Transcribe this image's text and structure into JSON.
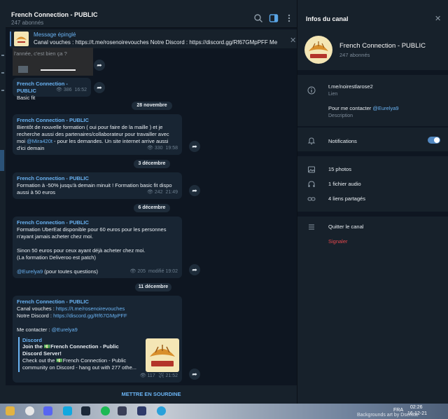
{
  "chat": {
    "title": "French Connection - PUBLIC",
    "subtitle": "247 abonnés",
    "pinned": {
      "label": "Message épinglé",
      "text": "Canal vouches : https://t.me/rosenoirevouches Notre Discord : https://discord.gg/Rf67GMpPFF  Me cont..."
    },
    "photo_caption_fragment": "l'année, c'est bien ça ?",
    "messages": [
      {
        "author": "French Connection - PUBLIC",
        "lines": [
          "Basic fit"
        ],
        "views": "386",
        "time": "16:52"
      },
      {
        "date": "28 novembre"
      },
      {
        "author": "French Connection - PUBLIC",
        "line1": "Bientôt de nouvelle formation ( oui pour faire de la maille ) et je",
        "line2": "recherche aussi des partenaires/collaborateur pour travailler avec",
        "line3_pre": "moi ",
        "line3_link": "@Mira420t",
        "line3_post": " - pour les demandes. Un site internet arrive aussi",
        "line4": "d'ici demain",
        "views": "330",
        "time": "19:58"
      },
      {
        "date": "3 décembre"
      },
      {
        "author": "French Connection - PUBLIC",
        "line1": "Formation à -50% jusqu'à demain minuit ! Formation basic fit dispo",
        "line2": "aussi à 50 euros",
        "views": "242",
        "time": "21:49"
      },
      {
        "date": "6 décembre"
      },
      {
        "author": "French Connection - PUBLIC",
        "line1": "Formation UberEat disponible pour 60 euros pour les personnes",
        "line2": "n'ayant jamais acheter chez moi.",
        "line3": "Sinon 50 euros pour ceux ayant déjà acheter chez moi.",
        "line4": "(La formation Deliveroo est patch)",
        "line5_link": "@Eurelya9",
        "line5_post": " (pour toutes questions)",
        "views": "205",
        "edited": "modifié",
        "time": "19:02"
      },
      {
        "date": "11 décembre"
      },
      {
        "author": "French Connection - PUBLIC",
        "l1_pre": "Canal vouches : ",
        "l1_link": "https://t.me/rosenoirevouches",
        "l2_pre": "Notre Discord : ",
        "l2_link": "https://discord.gg/Rf67GMpPFF",
        "l3_pre": "Me contacter : ",
        "l3_link": "@Eurelya9",
        "preview": {
          "source": "Discord",
          "title": "Join the 💵French Connection - Public Discord Server!",
          "desc": "Check out the 💵French Connection - Public community on Discord - hang out with 277 othe..."
        },
        "views": "117",
        "time": "21:52"
      }
    ],
    "mute_button": "METTRE EN SOURDINE"
  },
  "info": {
    "header": "Infos du canal",
    "name": "French Connection - PUBLIC",
    "subscribers": "247 abonnés",
    "link_value": "t.me/noirestlarose2",
    "link_label": "Lien",
    "description_pre": "Pour me contacter ",
    "description_link": "@Eurelya9",
    "description_label": "Description",
    "notifications_label": "Notifications",
    "notifications_on": true,
    "photos": "15 photos",
    "audio": "1 fichier audio",
    "links": "4 liens partagés",
    "leave": "Quitter le canal",
    "report": "Signaler"
  },
  "logo_text": "FRENCH CONNECTION",
  "taskbar": {
    "lang": "FRA",
    "time": "02:26",
    "date": "16-12-21",
    "wallpaper_credit": "Backgrounds art by Dsenxtc"
  },
  "colors": {
    "bg": "#0e1621",
    "panel": "#17212b",
    "bubble": "#182533",
    "accent": "#6ab3f3",
    "danger": "#e5484d"
  }
}
